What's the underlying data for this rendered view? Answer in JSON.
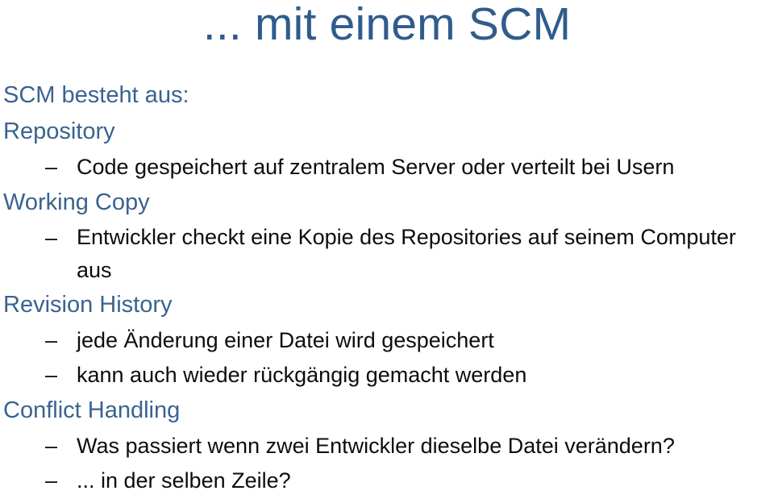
{
  "slide": {
    "title": "... mit einem SCM",
    "intro": "SCM besteht aus:",
    "colors": {
      "title_blue": "#2f5c8c",
      "heading_blue": "#3a638f",
      "body_black": "#0d0d0d",
      "background": "#ffffff"
    },
    "bullet_glyph": "–",
    "sections": [
      {
        "heading": "Repository",
        "items": [
          "Code gespeichert auf zentralem Server oder verteilt bei Usern"
        ]
      },
      {
        "heading": "Working Copy",
        "items": [
          "Entwickler checkt eine Kopie des Repositories auf seinem Computer aus"
        ]
      },
      {
        "heading": "Revision History",
        "items": [
          "jede Änderung einer Datei wird gespeichert",
          "kann auch wieder rückgängig gemacht werden"
        ]
      },
      {
        "heading": "Conflict Handling",
        "items": [
          "Was passiert wenn zwei Entwickler dieselbe Datei verändern?",
          "... in der selben Zeile?"
        ]
      }
    ]
  }
}
